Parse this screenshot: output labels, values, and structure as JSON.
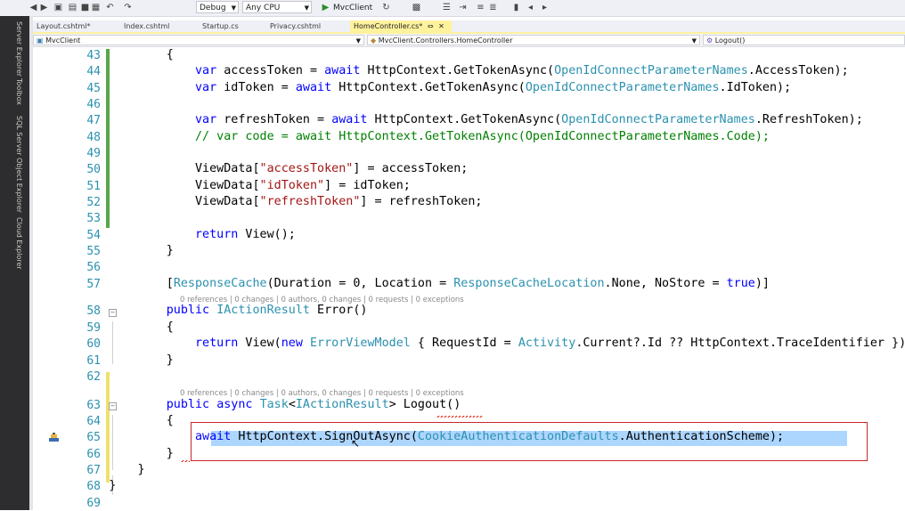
{
  "toolbar": {
    "config": "Debug",
    "platform": "Any CPU",
    "start_target": "MvcClient",
    "start_icon": "play-icon"
  },
  "side_tabs": [
    "Server Explorer",
    "Toolbox",
    "SQL Server Object Explorer",
    "Cloud Explorer"
  ],
  "tabs": [
    {
      "label": "Layout.cshtml*",
      "active": false
    },
    {
      "label": "Index.cshtml",
      "active": false
    },
    {
      "label": "Startup.cs",
      "active": false
    },
    {
      "label": "Privacy.cshtml",
      "active": false
    },
    {
      "label": "HomeController.cs*",
      "active": true,
      "pin": "⇔",
      "close": "✕"
    }
  ],
  "navbar": {
    "project": "MvcClient",
    "type": "MvcClient.Controllers.HomeController",
    "member": "Logout()"
  },
  "code_lines": [
    {
      "n": "43",
      "segs": [
        [
          "p",
          "            {"
        ]
      ]
    },
    {
      "n": "44",
      "segs": [
        [
          "p",
          "                "
        ],
        [
          "k",
          "var"
        ],
        [
          "p",
          " accessToken = "
        ],
        [
          "k",
          "await"
        ],
        [
          "p",
          " HttpContext.GetTokenAsync("
        ],
        [
          "t",
          "OpenIdConnectParameterNames"
        ],
        [
          "p",
          ".AccessToken);"
        ]
      ]
    },
    {
      "n": "45",
      "segs": [
        [
          "p",
          "                "
        ],
        [
          "k",
          "var"
        ],
        [
          "p",
          " idToken = "
        ],
        [
          "k",
          "await"
        ],
        [
          "p",
          " HttpContext.GetTokenAsync("
        ],
        [
          "t",
          "OpenIdConnectParameterNames"
        ],
        [
          "p",
          ".IdToken);"
        ]
      ]
    },
    {
      "n": "46",
      "segs": []
    },
    {
      "n": "47",
      "segs": [
        [
          "p",
          "                "
        ],
        [
          "k",
          "var"
        ],
        [
          "p",
          " refreshToken = "
        ],
        [
          "k",
          "await"
        ],
        [
          "p",
          " HttpContext.GetTokenAsync("
        ],
        [
          "t",
          "OpenIdConnectParameterNames"
        ],
        [
          "p",
          ".RefreshToken);"
        ]
      ]
    },
    {
      "n": "48",
      "segs": [
        [
          "p",
          "                "
        ],
        [
          "c",
          "// var code = await HttpContext.GetTokenAsync(OpenIdConnectParameterNames.Code);"
        ]
      ]
    },
    {
      "n": "49",
      "segs": []
    },
    {
      "n": "50",
      "segs": [
        [
          "p",
          "                ViewData["
        ],
        [
          "s",
          "\"accessToken\""
        ],
        [
          "p",
          "] = accessToken;"
        ]
      ]
    },
    {
      "n": "51",
      "segs": [
        [
          "p",
          "                ViewData["
        ],
        [
          "s",
          "\"idToken\""
        ],
        [
          "p",
          "] = idToken;"
        ]
      ]
    },
    {
      "n": "52",
      "segs": [
        [
          "p",
          "                ViewData["
        ],
        [
          "s",
          "\"refreshToken\""
        ],
        [
          "p",
          "] = refreshToken;"
        ]
      ]
    },
    {
      "n": "53",
      "segs": []
    },
    {
      "n": "54",
      "segs": [
        [
          "p",
          "                "
        ],
        [
          "k",
          "return"
        ],
        [
          "p",
          " View();"
        ]
      ]
    },
    {
      "n": "55",
      "segs": [
        [
          "p",
          "            }"
        ]
      ]
    },
    {
      "n": "56",
      "segs": []
    },
    {
      "n": "57",
      "segs": [
        [
          "p",
          "            ["
        ],
        [
          "t",
          "ResponseCache"
        ],
        [
          "p",
          "(Duration = 0, Location = "
        ],
        [
          "t",
          "ResponseCacheLocation"
        ],
        [
          "p",
          ".None, NoStore = "
        ],
        [
          "k",
          "true"
        ],
        [
          "p",
          ")]"
        ]
      ]
    },
    {
      "n": "58",
      "segs": [
        [
          "p",
          "            "
        ],
        [
          "k",
          "public"
        ],
        [
          "p",
          " "
        ],
        [
          "t",
          "IActionResult"
        ],
        [
          "p",
          " Error()"
        ]
      ]
    },
    {
      "n": "59",
      "segs": [
        [
          "p",
          "            {"
        ]
      ]
    },
    {
      "n": "60",
      "segs": [
        [
          "p",
          "                "
        ],
        [
          "k",
          "return"
        ],
        [
          "p",
          " View("
        ],
        [
          "k",
          "new"
        ],
        [
          "p",
          " "
        ],
        [
          "t",
          "ErrorViewModel"
        ],
        [
          "p",
          " { RequestId = "
        ],
        [
          "t",
          "Activity"
        ],
        [
          "p",
          ".Current?.Id ?? HttpContext.TraceIdentifier });"
        ]
      ]
    },
    {
      "n": "61",
      "segs": [
        [
          "p",
          "            }"
        ]
      ]
    },
    {
      "n": "62",
      "segs": []
    },
    {
      "n": "63",
      "segs": [
        [
          "p",
          "            "
        ],
        [
          "k",
          "public"
        ],
        [
          "p",
          " "
        ],
        [
          "k",
          "async"
        ],
        [
          "p",
          " "
        ],
        [
          "t",
          "Task"
        ],
        [
          "p",
          "<"
        ],
        [
          "t",
          "IActionResult"
        ],
        [
          "p",
          "> Logout()"
        ]
      ]
    },
    {
      "n": "64",
      "segs": [
        [
          "p",
          "            {"
        ]
      ]
    },
    {
      "n": "65",
      "segs": [
        [
          "p",
          "                "
        ],
        [
          "k",
          "await"
        ],
        [
          "p",
          " HttpContext.SignOutAsync("
        ],
        [
          "t",
          "CookieAuthenticationDefaults"
        ],
        [
          "p",
          ".AuthenticationScheme);"
        ]
      ]
    },
    {
      "n": "66",
      "segs": [
        [
          "p",
          "            }"
        ]
      ]
    },
    {
      "n": "67",
      "segs": [
        [
          "p",
          "        }"
        ]
      ]
    },
    {
      "n": "68",
      "segs": [
        [
          "p",
          "    }"
        ]
      ]
    },
    {
      "n": "69",
      "segs": []
    }
  ],
  "codelens": {
    "error": "0 references | 0 changes | 0 authors, 0 changes | 0 requests | 0 exceptions",
    "logout": "0 references | 0 changes | 0 authors, 0 changes | 0 requests | 0 exceptions"
  },
  "colors": {
    "keyword": "#0000ff",
    "type": "#2b91af",
    "string": "#a31515",
    "comment": "#008000",
    "line_number": "#2b91af",
    "selection": "#add6ff",
    "highlight_box": "#c8262a",
    "active_tab": "#fff29d"
  },
  "icons": {
    "margin_indicator": "quick-action-icon"
  }
}
